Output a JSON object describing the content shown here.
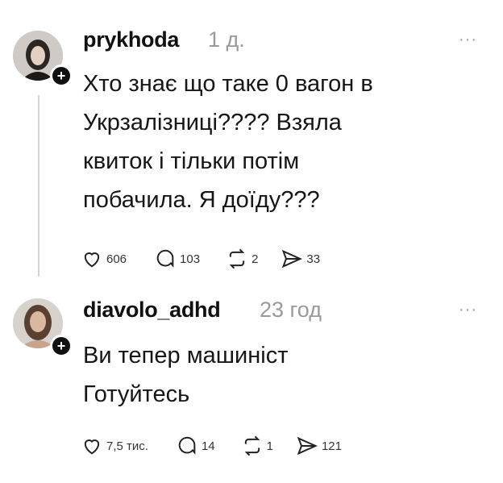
{
  "posts": [
    {
      "username": "prykhoda",
      "time": "1 д.",
      "more": "···",
      "text": "Хто знає що таке 0 вагон в\nУкрзалізниці???? Взяла\nквиток і тільки потім\nпобачила. Я доїду???",
      "likes": "606",
      "replies": "103",
      "reposts": "2",
      "shares": "33"
    },
    {
      "username": "diavolo_adhd",
      "time": "23 год",
      "more": "···",
      "text": "Ви тепер машиніст\nГотуйтесь",
      "likes": "7,5 тис.",
      "replies": "14",
      "reposts": "1",
      "shares": "121"
    }
  ],
  "icons": {
    "follow": "+",
    "like": "heart-icon",
    "reply": "comment-icon",
    "repost": "repost-icon",
    "share": "send-icon"
  }
}
